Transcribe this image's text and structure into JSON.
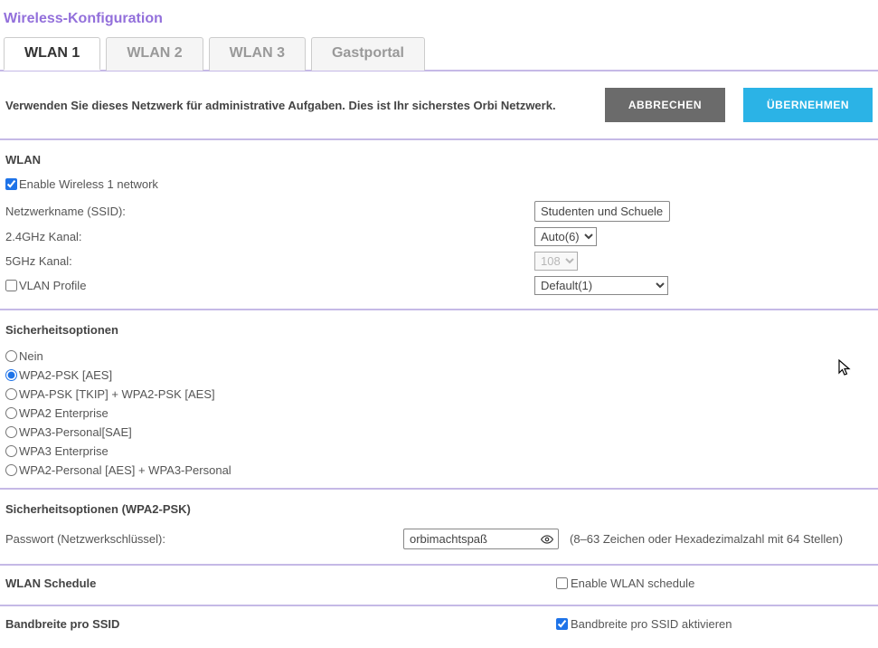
{
  "title": "Wireless-Konfiguration",
  "tabs": {
    "t1": "WLAN 1",
    "t2": "WLAN 2",
    "t3": "WLAN 3",
    "t4": "Gastportal"
  },
  "action": {
    "description": "Verwenden Sie dieses Netzwerk für administrative Aufgaben. Dies ist Ihr sicherstes Orbi Netzwerk.",
    "cancel": "ABBRECHEN",
    "apply": "ÜBERNEHMEN"
  },
  "wlan": {
    "heading": "WLAN",
    "enable_label": "Enable Wireless 1 network",
    "ssid_label": "Netzwerkname (SSID):",
    "ssid_value": "Studenten und Schueler",
    "ch24_label": "2.4GHz Kanal:",
    "ch24_value": "Auto(6)",
    "ch5_label": "5GHz Kanal:",
    "ch5_value": "108",
    "vlan_label": "VLAN Profile",
    "vlan_value": "Default(1)"
  },
  "security": {
    "heading": "Sicherheitsoptionen",
    "options": {
      "none": "Nein",
      "wpa2psk": "WPA2-PSK [AES]",
      "mixedpsk": "WPA-PSK [TKIP] + WPA2-PSK [AES]",
      "wpa2ent": "WPA2 Enterprise",
      "wpa3sae": "WPA3-Personal[SAE]",
      "wpa3ent": "WPA3 Enterprise",
      "wpa2wpa3": "WPA2-Personal [AES] + WPA3-Personal"
    }
  },
  "psk": {
    "heading": "Sicherheitsoptionen (WPA2-PSK)",
    "pw_label": "Passwort (Netzwerkschlüssel):",
    "pw_value": "orbimachtspaß",
    "pw_hint": "(8–63 Zeichen oder Hexadezimalzahl mit 64 Stellen)"
  },
  "schedule": {
    "heading": "WLAN Schedule",
    "enable": "Enable WLAN schedule"
  },
  "bandwidth": {
    "heading": "Bandbreite pro SSID",
    "enable": "Bandbreite pro SSID aktivieren"
  }
}
